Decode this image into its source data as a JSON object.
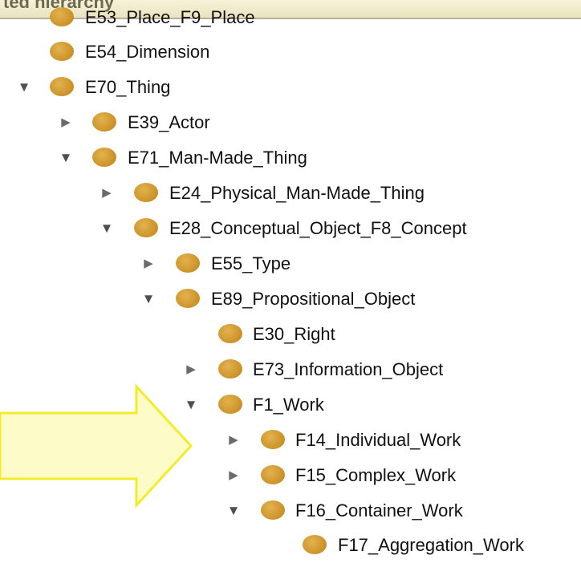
{
  "header": {
    "title": "ted hierarchy"
  },
  "tree": {
    "nodes": [
      {
        "label": "E53_Place_F9_Place",
        "toggle": "none"
      },
      {
        "label": "E54_Dimension",
        "toggle": "none"
      },
      {
        "label": "E70_Thing",
        "toggle": "expanded"
      },
      {
        "label": "E39_Actor",
        "toggle": "collapsed"
      },
      {
        "label": "E71_Man-Made_Thing",
        "toggle": "expanded"
      },
      {
        "label": "E24_Physical_Man-Made_Thing",
        "toggle": "collapsed"
      },
      {
        "label": "E28_Conceptual_Object_F8_Concept",
        "toggle": "expanded"
      },
      {
        "label": "E55_Type",
        "toggle": "collapsed"
      },
      {
        "label": "E89_Propositional_Object",
        "toggle": "expanded"
      },
      {
        "label": "E30_Right",
        "toggle": "none"
      },
      {
        "label": "E73_Information_Object",
        "toggle": "collapsed"
      },
      {
        "label": "F1_Work",
        "toggle": "expanded"
      },
      {
        "label": "F14_Individual_Work",
        "toggle": "collapsed"
      },
      {
        "label": "F15_Complex_Work",
        "toggle": "collapsed"
      },
      {
        "label": "F16_Container_Work",
        "toggle": "expanded"
      },
      {
        "label": "F17_Aggregation_Work",
        "toggle": "none"
      }
    ]
  },
  "icons": {
    "expanded": "triangle-down-icon",
    "collapsed": "triangle-right-icon",
    "node": "class-dot-icon"
  },
  "colors": {
    "node_dot": "#cc9127",
    "arrow_fill": "#fdfbc8",
    "arrow_stroke": "#f2ec2a",
    "header_bg": "#efe9c9"
  }
}
